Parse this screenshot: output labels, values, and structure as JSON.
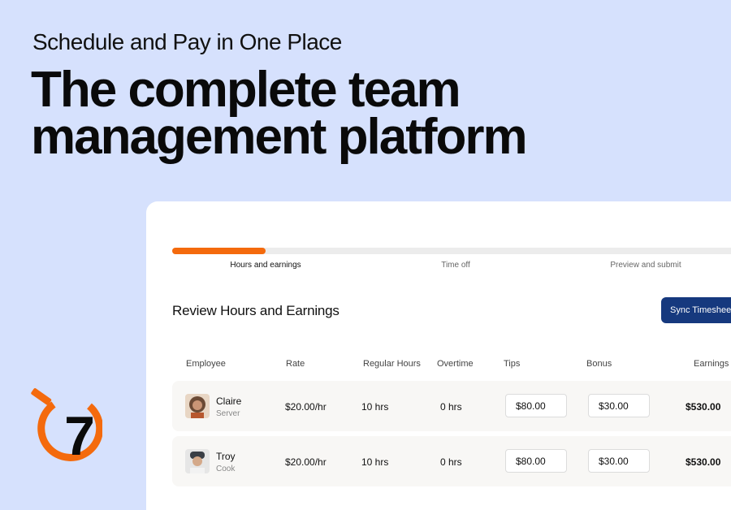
{
  "hero": {
    "eyebrow": "Schedule and Pay in One Place",
    "headline_line1": "The complete team",
    "headline_line2": "management platform"
  },
  "brand": {
    "logo_mark": "7",
    "accent": "#f46a0d",
    "primary": "#16397e",
    "background": "#d6e1fd"
  },
  "progress": {
    "completed_fraction": 0.16
  },
  "steps": [
    "Hours and earnings",
    "Time off",
    "Preview and submit"
  ],
  "section": {
    "title": "Review Hours and Earnings",
    "sync_label": "Sync Timesheet"
  },
  "table": {
    "headers": [
      "Employee",
      "Rate",
      "Regular Hours",
      "Overtime",
      "Tips",
      "Bonus",
      "Earnings"
    ],
    "rows": [
      {
        "name": "Claire",
        "role": "Server",
        "rate": "$20.00/hr",
        "regular": "10 hrs",
        "overtime": "0 hrs",
        "tips": "$80.00",
        "bonus": "$30.00",
        "earnings": "$530.00"
      },
      {
        "name": "Troy",
        "role": "Cook",
        "rate": "$20.00/hr",
        "regular": "10 hrs",
        "overtime": "0 hrs",
        "tips": "$80.00",
        "bonus": "$30.00",
        "earnings": "$530.00"
      }
    ]
  }
}
